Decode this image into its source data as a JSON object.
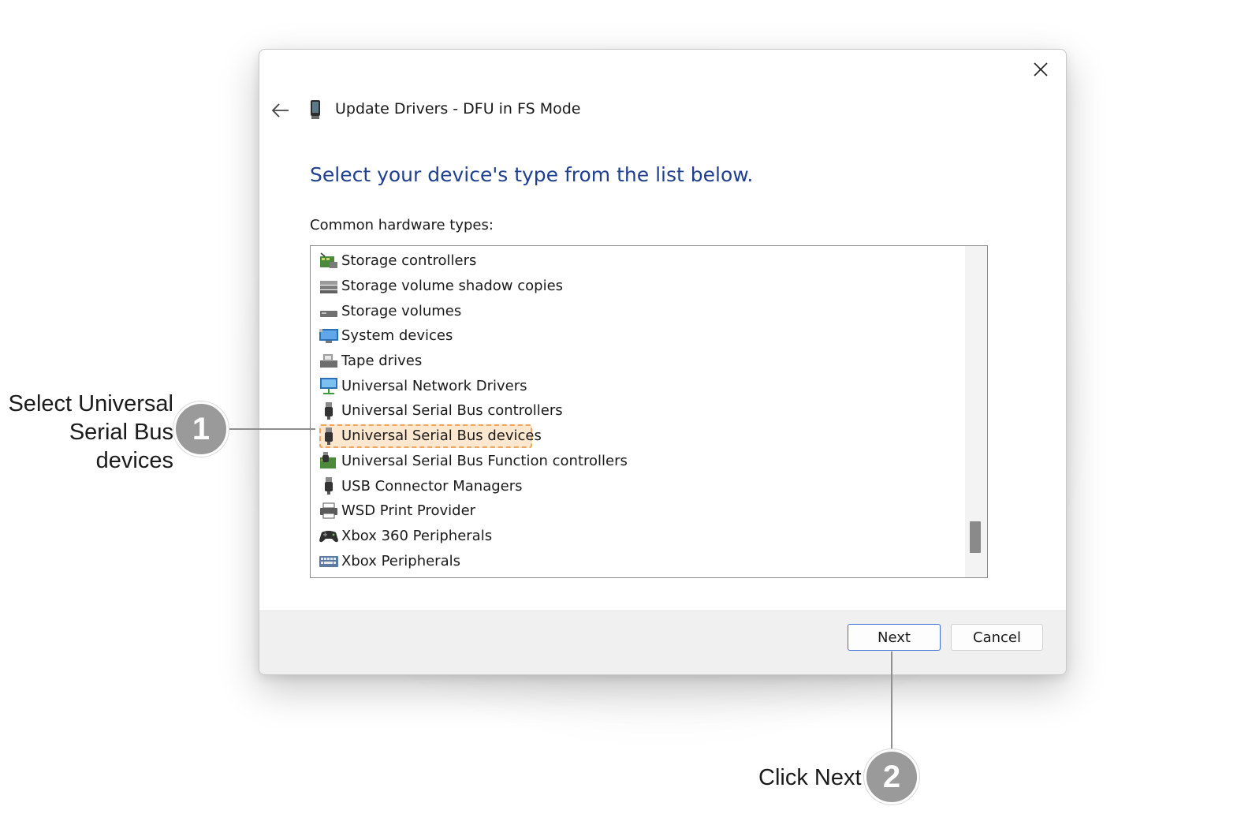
{
  "dialog": {
    "title": "Update Drivers - DFU in FS Mode",
    "instruction": "Select your device's type from the list below.",
    "list_label": "Common hardware types:",
    "items": [
      {
        "label": "Storage controllers",
        "icon": "storage-controller-icon"
      },
      {
        "label": "Storage volume shadow copies",
        "icon": "disk-drive-icon"
      },
      {
        "label": "Storage volumes",
        "icon": "storage-volume-icon"
      },
      {
        "label": "System devices",
        "icon": "monitor-icon"
      },
      {
        "label": "Tape drives",
        "icon": "tape-drive-icon"
      },
      {
        "label": "Universal Network Drivers",
        "icon": "network-monitor-icon"
      },
      {
        "label": "Universal Serial Bus controllers",
        "icon": "usb-plug-icon"
      },
      {
        "label": "Universal Serial Bus devices",
        "icon": "usb-plug-icon",
        "highlighted": true
      },
      {
        "label": "Universal Serial Bus Function controllers",
        "icon": "usb-function-icon"
      },
      {
        "label": "USB Connector Managers",
        "icon": "usb-plug-icon"
      },
      {
        "label": "WSD Print Provider",
        "icon": "printer-icon"
      },
      {
        "label": "Xbox 360 Peripherals",
        "icon": "gamepad-icon"
      },
      {
        "label": "Xbox Peripherals",
        "icon": "keyboard-icon"
      }
    ],
    "buttons": {
      "next": "Next",
      "cancel": "Cancel"
    },
    "accent_color": "#1f3f8f",
    "highlight_color": "#fde7cf"
  },
  "callouts": [
    {
      "number": "1",
      "text": "Select Universal Serial Bus devices"
    },
    {
      "number": "2",
      "text": "Click Next"
    }
  ]
}
